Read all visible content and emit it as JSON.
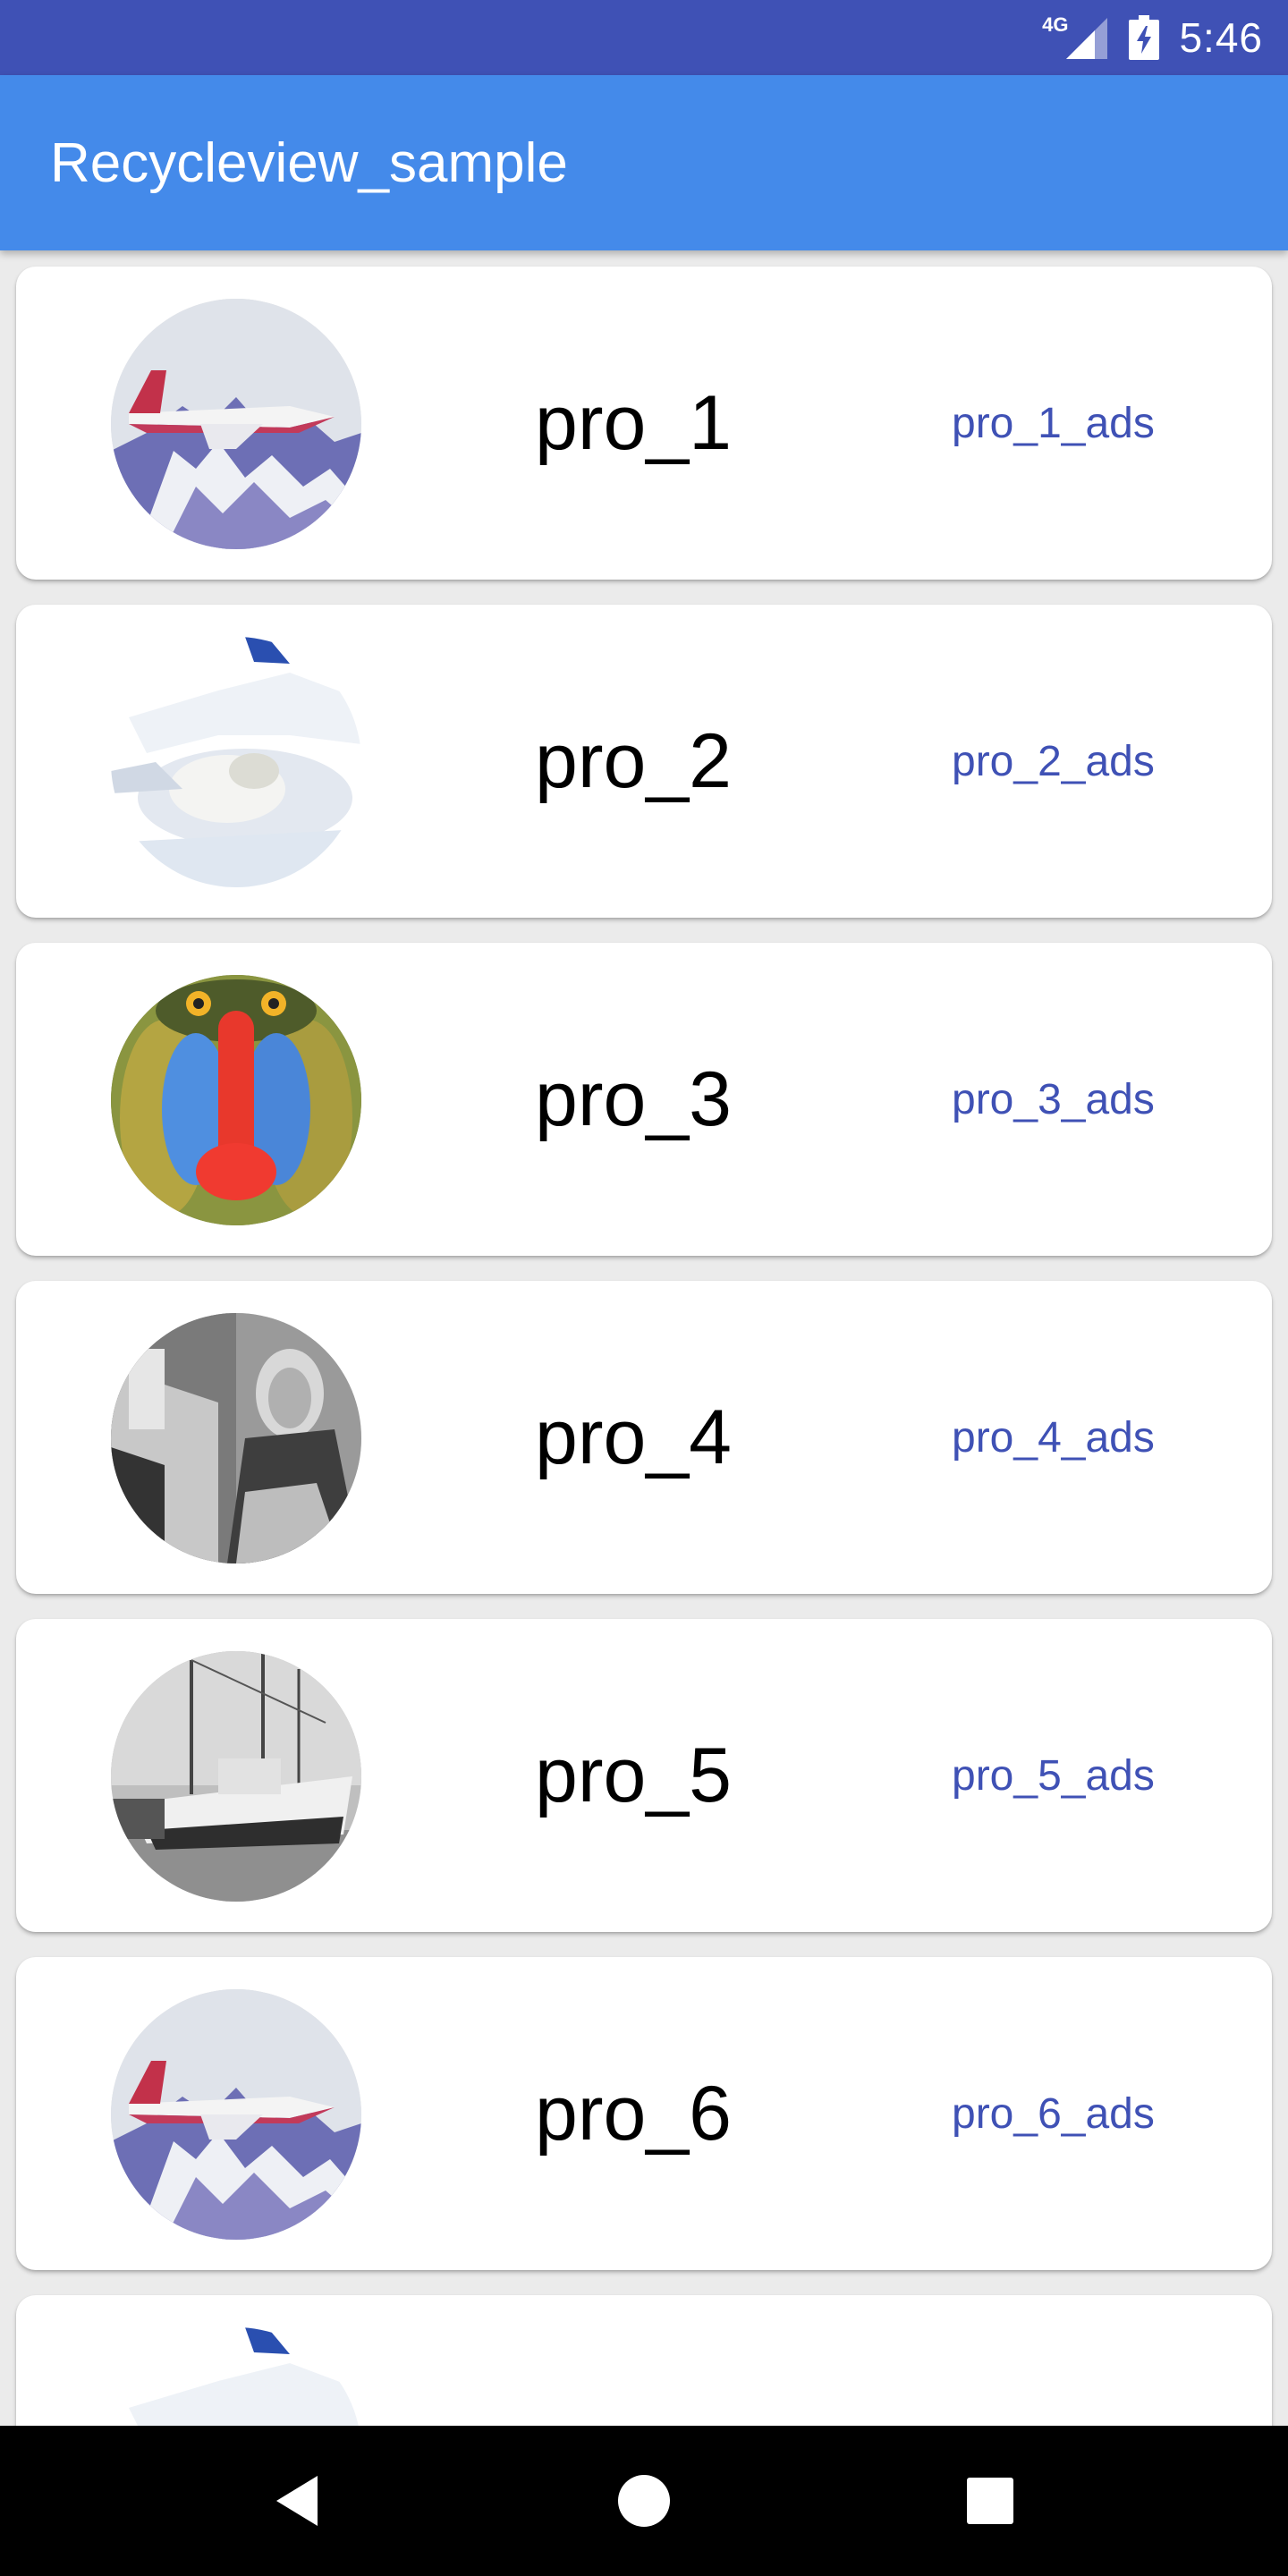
{
  "status_bar": {
    "network": "4G",
    "time": "5:46",
    "icons": [
      "signal-icon",
      "battery-charging-icon"
    ]
  },
  "app_bar": {
    "title": "Recycleview_sample"
  },
  "list": {
    "items": [
      {
        "title": "pro_1",
        "ads": "pro_1_ads",
        "image": "jet-over-mountains"
      },
      {
        "title": "pro_2",
        "ads": "pro_2_ads",
        "image": "snowy-scene"
      },
      {
        "title": "pro_3",
        "ads": "pro_3_ads",
        "image": "mandrill"
      },
      {
        "title": "pro_4",
        "ads": "pro_4_ads",
        "image": "woman-grayscale"
      },
      {
        "title": "pro_5",
        "ads": "pro_5_ads",
        "image": "boats-grayscale"
      },
      {
        "title": "pro_6",
        "ads": "pro_6_ads",
        "image": "jet-over-mountains"
      },
      {
        "title": "",
        "ads": "",
        "image": "snowy-scene"
      }
    ]
  },
  "nav_bar": {
    "buttons": [
      "back-icon",
      "home-icon",
      "recents-icon"
    ]
  },
  "colors": {
    "status_bar": "#3f51b5",
    "app_bar": "#448aea",
    "ads_text": "#3f51b5",
    "background": "#ebebeb"
  }
}
